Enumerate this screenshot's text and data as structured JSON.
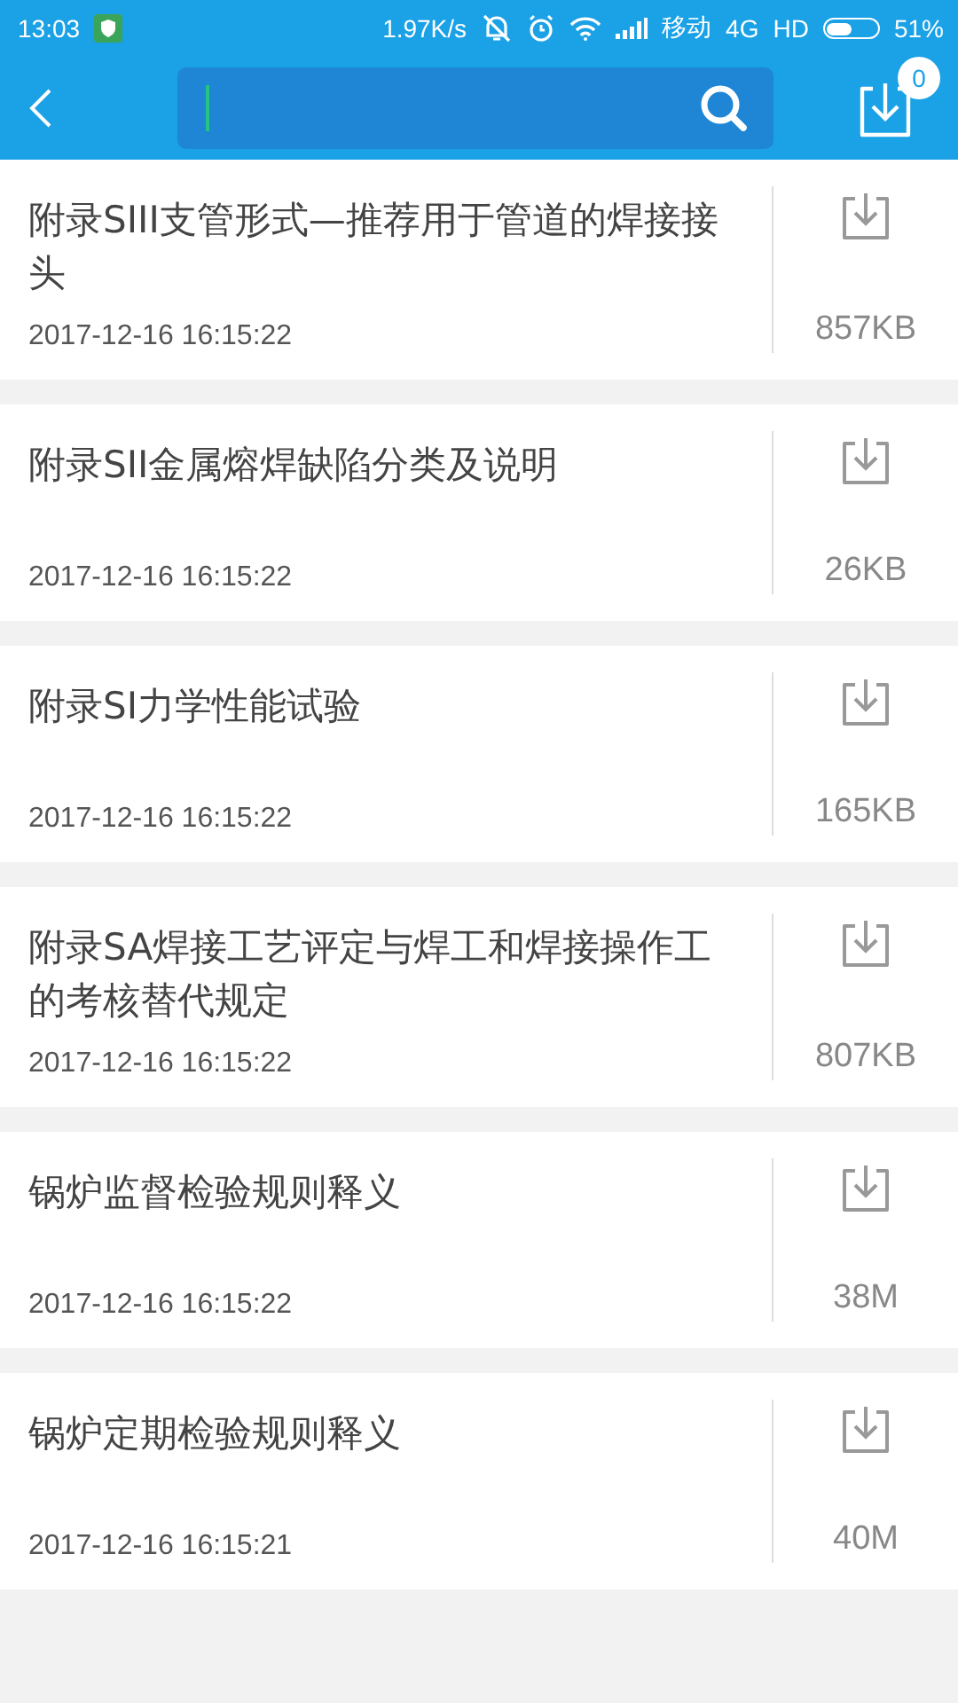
{
  "status_bar": {
    "time": "13:03",
    "speed": "1.97K/s",
    "carrier": "移动",
    "network": "4G",
    "hd": "HD",
    "battery": "51%"
  },
  "header": {
    "download_count": "0"
  },
  "files": [
    {
      "title": "附录SIII支管形式—推荐用于管道的焊接接头",
      "date": "2017-12-16 16:15:22",
      "size": "857KB"
    },
    {
      "title": "附录SII金属熔焊缺陷分类及说明",
      "date": "2017-12-16 16:15:22",
      "size": "26KB"
    },
    {
      "title": "附录SI力学性能试验",
      "date": "2017-12-16 16:15:22",
      "size": "165KB"
    },
    {
      "title": "附录SA焊接工艺评定与焊工和焊接操作工的考核替代规定",
      "date": "2017-12-16 16:15:22",
      "size": "807KB"
    },
    {
      "title": "锅炉监督检验规则释义",
      "date": "2017-12-16 16:15:22",
      "size": "38M"
    },
    {
      "title": "锅炉定期检验规则释义",
      "date": "2017-12-16 16:15:21",
      "size": "40M"
    }
  ]
}
